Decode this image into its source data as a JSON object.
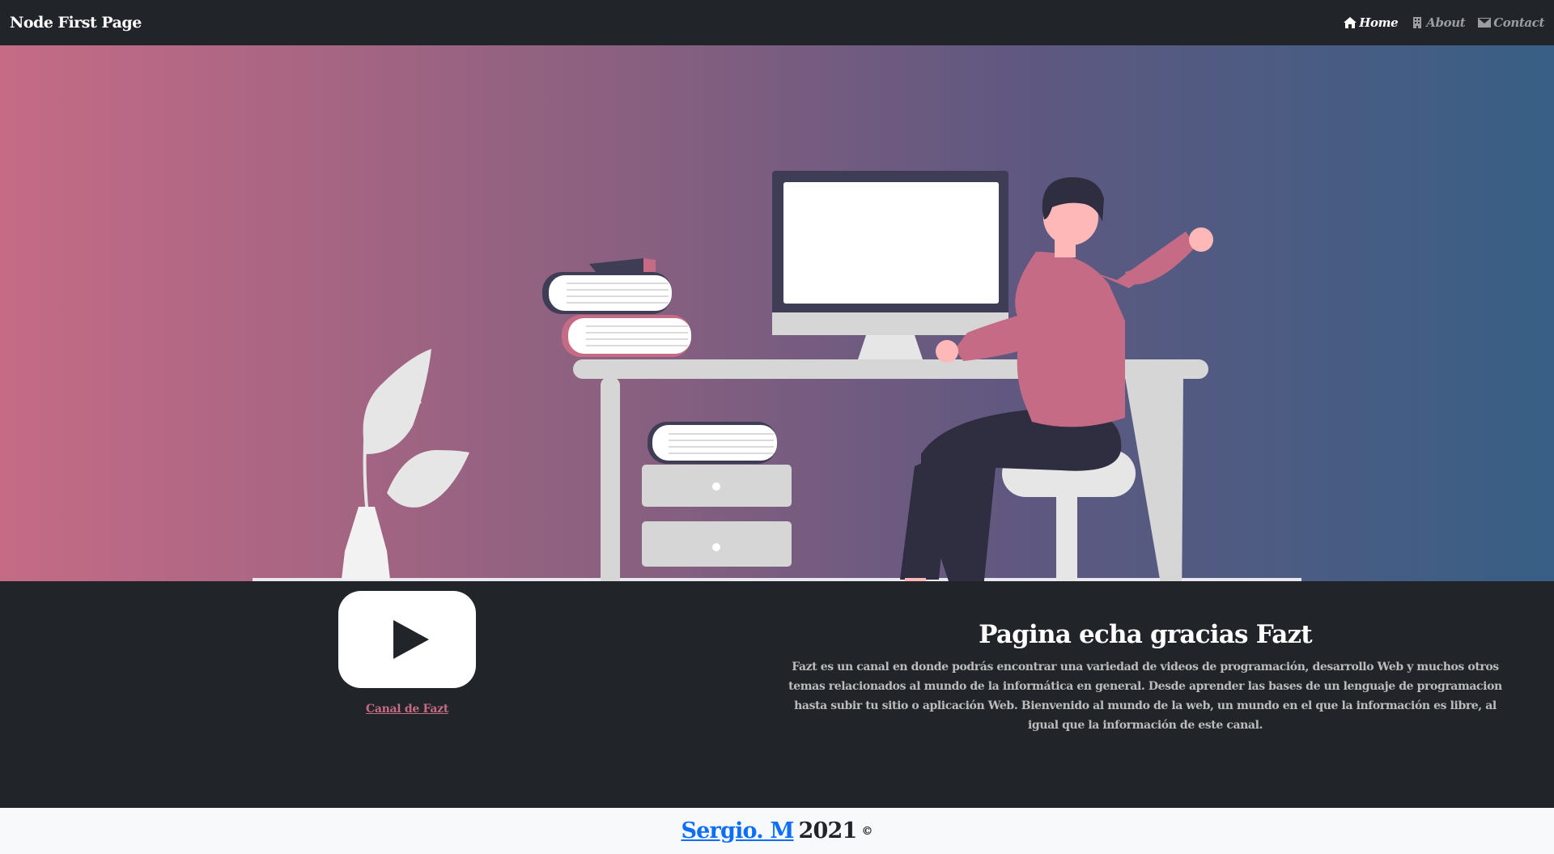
{
  "navbar": {
    "brand": "Node First Page",
    "links": [
      {
        "label": "Home",
        "icon": "home-icon",
        "active": true
      },
      {
        "label": "About",
        "icon": "building-icon",
        "active": false
      },
      {
        "label": "Contact",
        "icon": "envelope-icon",
        "active": false
      }
    ]
  },
  "hero": {
    "gradient": [
      "#c56b86",
      "#385f85"
    ],
    "illustration": "person-working-at-desk-illustration"
  },
  "info": {
    "video_icon": "youtube-play-icon",
    "channel_link": "Canal de Fazt",
    "heading": "Pagina echa gracias Fazt",
    "paragraph": "Fazt es un canal en donde podrás encontrar una variedad de videos de programación, desarrollo Web y muchos otros temas relacionados al mundo de la informática en general. Desde aprender las bases de un lenguaje de programacion hasta subir tu sitio o aplicación Web. Bienvenido al mundo de la web, un mundo en el que la información es libre, al igual que la información de este canal."
  },
  "footer": {
    "author": "Sergio. M",
    "year": "2021",
    "copyright": "©"
  },
  "colors": {
    "navbar_bg": "#212529",
    "accent_pink": "#c56b86",
    "link_blue": "#0d6efd",
    "footer_bg": "#f8f9fa"
  }
}
